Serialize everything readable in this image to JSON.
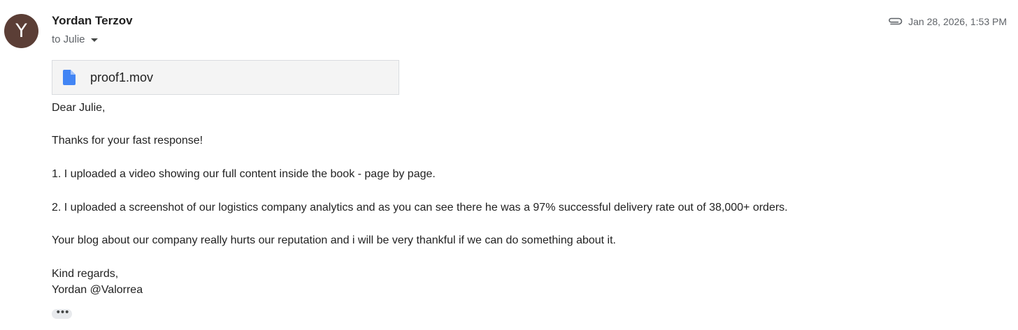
{
  "sender": {
    "avatar_letter": "Y",
    "avatar_color": "#5b3e36",
    "name": "Yordan Terzov",
    "recipient_line": "to Julie"
  },
  "meta": {
    "attachment_icon": "paperclip-icon",
    "date": "Jan 28, 2026, 1:53 PM"
  },
  "attachment": {
    "icon": "file-icon",
    "icon_color": "#4285f4",
    "file_name": "proof1.mov"
  },
  "body": {
    "greeting": "Dear Julie,",
    "line1": "Thanks for your fast response!",
    "line2": "1. I uploaded a video showing our full content inside the book - page by page.",
    "line3": "2. I uploaded a screenshot of our logistics company analytics and as you can see there he was a 97% successful delivery rate out of 38,000+ orders.",
    "line4": "Your blog about our company really hurts our reputation and i will be very thankful if we can do something about it.",
    "signoff": "Kind regards,",
    "signature": "Yordan @Valorrea"
  },
  "trimmed_content": {
    "icon": "more-horizontal-icon",
    "glyph": "•••"
  }
}
